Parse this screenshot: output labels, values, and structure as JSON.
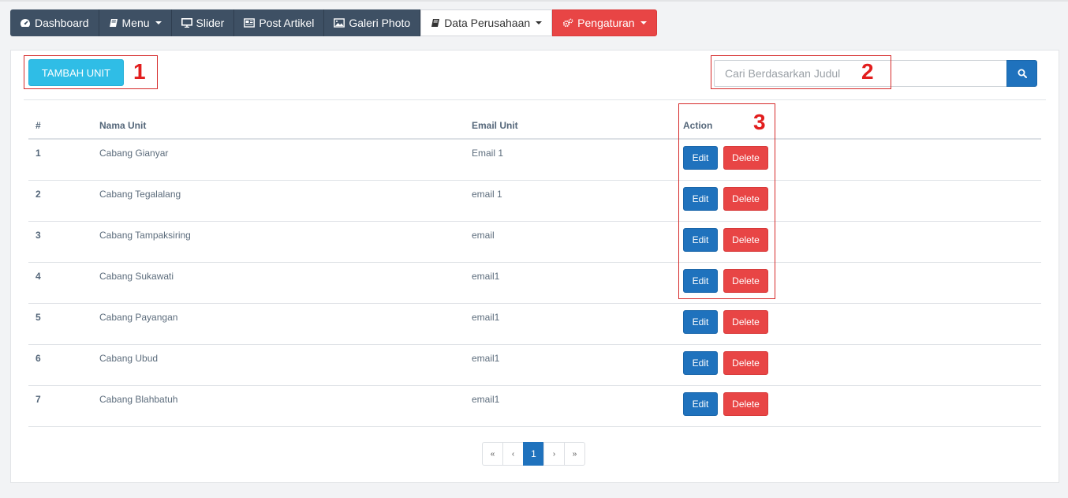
{
  "navbar": {
    "items": [
      {
        "label": "Dashboard",
        "icon": "dashboard-icon",
        "dropdown": false
      },
      {
        "label": "Menu",
        "icon": "book-icon",
        "dropdown": true
      },
      {
        "label": "Slider",
        "icon": "monitor-icon",
        "dropdown": false
      },
      {
        "label": "Post Artikel",
        "icon": "newspaper-icon",
        "dropdown": false
      },
      {
        "label": "Galeri Photo",
        "icon": "image-icon",
        "dropdown": false
      },
      {
        "label": "Data Perusahaan",
        "icon": "book-icon",
        "dropdown": true
      },
      {
        "label": "Pengaturan",
        "icon": "gears-icon",
        "dropdown": true
      }
    ]
  },
  "toolbar": {
    "add_label": "TAMBAH UNIT",
    "search_placeholder": "Cari Berdasarkan Judul"
  },
  "table": {
    "headers": [
      "#",
      "Nama Unit",
      "Email Unit",
      "Action"
    ],
    "rows": [
      {
        "no": "1",
        "name": "Cabang Gianyar",
        "email": "Email 1"
      },
      {
        "no": "2",
        "name": "Cabang Tegalalang",
        "email": "email 1"
      },
      {
        "no": "3",
        "name": "Cabang Tampaksiring",
        "email": "email"
      },
      {
        "no": "4",
        "name": "Cabang Sukawati",
        "email": "email1"
      },
      {
        "no": "5",
        "name": "Cabang Payangan",
        "email": "email1"
      },
      {
        "no": "6",
        "name": "Cabang Ubud",
        "email": "email1"
      },
      {
        "no": "7",
        "name": "Cabang Blahbatuh",
        "email": "email1"
      }
    ],
    "edit_label": "Edit",
    "delete_label": "Delete"
  },
  "pagination": {
    "first": "«",
    "prev": "‹",
    "current": "1",
    "next": "›",
    "last": "»"
  },
  "annotations": [
    "1",
    "2",
    "3"
  ],
  "colors": {
    "nav_dark": "#3e5064",
    "danger": "#e84545",
    "primary": "#1f72bd",
    "info": "#2fbde6",
    "annotation": "#e21e1e"
  }
}
